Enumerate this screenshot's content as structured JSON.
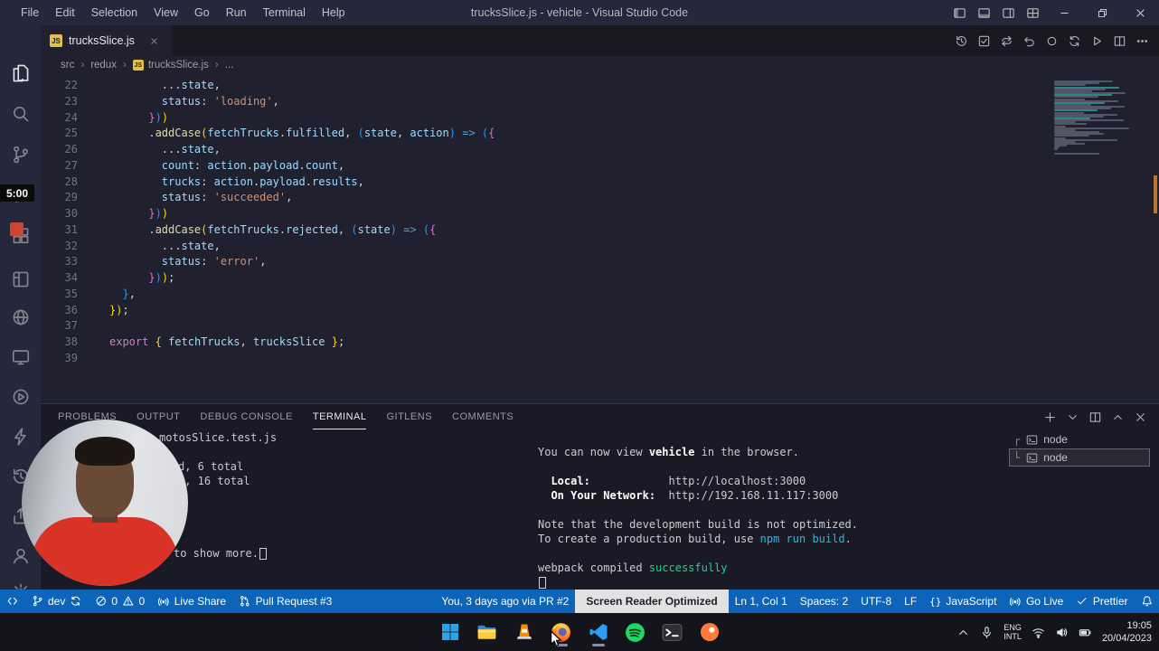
{
  "colors": {
    "statusbar": "#0d64b8",
    "recording_red": "#cf4436",
    "js_yellow": "#e3c04a",
    "cyan": "#29b8db",
    "success_green": "#23d18b"
  },
  "titlebar": {
    "menus": [
      "File",
      "Edit",
      "Selection",
      "View",
      "Go",
      "Run",
      "Terminal",
      "Help"
    ],
    "title": "trucksSlice.js - vehicle - Visual Studio Code"
  },
  "tabbar": {
    "tab_label": "trucksSlice.js",
    "js_badge": "JS",
    "actions": [
      "history",
      "tasks",
      "compare",
      "undo",
      "record",
      "sync",
      "run",
      "split",
      "more"
    ]
  },
  "breadcrumb": [
    "src",
    "redux",
    "trucksSlice.js",
    "..."
  ],
  "activitybar": {
    "recording_timer": "5:00",
    "items": [
      {
        "name": "explorer",
        "icon": "explorer"
      },
      {
        "name": "search",
        "icon": "search"
      },
      {
        "name": "source-control",
        "icon": "scm"
      },
      {
        "name": "run-and-debug",
        "icon": "debug"
      },
      {
        "name": "extensions",
        "icon": "ext"
      },
      {
        "name": "editor-layout",
        "icon": "layout"
      },
      {
        "name": "live-share",
        "icon": "globe"
      },
      {
        "name": "remote-explorer",
        "icon": "monitor"
      },
      {
        "name": "run-app",
        "icon": "playc"
      },
      {
        "name": "thunder-client",
        "icon": "bolt"
      },
      {
        "name": "timeline",
        "icon": "history"
      },
      {
        "name": "share",
        "icon": "share"
      },
      {
        "name": "accounts",
        "icon": "person"
      },
      {
        "name": "manage",
        "icon": "gear"
      }
    ]
  },
  "editor": {
    "lines": [
      {
        "n": 22,
        "s": [
          [
            "d",
            "        ..."
          ],
          [
            "v",
            "state"
          ],
          [
            "d",
            ","
          ]
        ]
      },
      {
        "n": 23,
        "s": [
          [
            "d",
            "        "
          ],
          [
            "v",
            "status"
          ],
          [
            "d",
            ": "
          ],
          [
            "s",
            "'loading'"
          ],
          [
            "d",
            ","
          ]
        ]
      },
      {
        "n": 24,
        "s": [
          [
            "d",
            "      "
          ],
          [
            "p",
            "}"
          ],
          [
            "u",
            ")"
          ],
          [
            "g",
            ")"
          ]
        ]
      },
      {
        "n": 25,
        "s": [
          [
            "d",
            "      ."
          ],
          [
            "f",
            "addCase"
          ],
          [
            "g",
            "("
          ],
          [
            "v",
            "fetchTrucks"
          ],
          [
            "d",
            "."
          ],
          [
            "v",
            "fulfilled"
          ],
          [
            "d",
            ", "
          ],
          [
            "u",
            "("
          ],
          [
            "v",
            "state"
          ],
          [
            "d",
            ", "
          ],
          [
            "v",
            "action"
          ],
          [
            "u",
            ")"
          ],
          [
            "a",
            " => "
          ],
          [
            "u",
            "("
          ],
          [
            "p",
            "{"
          ]
        ]
      },
      {
        "n": 26,
        "s": [
          [
            "d",
            "        ..."
          ],
          [
            "v",
            "state"
          ],
          [
            "d",
            ","
          ]
        ]
      },
      {
        "n": 27,
        "s": [
          [
            "d",
            "        "
          ],
          [
            "v",
            "count"
          ],
          [
            "d",
            ": "
          ],
          [
            "v",
            "action"
          ],
          [
            "d",
            "."
          ],
          [
            "v",
            "payload"
          ],
          [
            "d",
            "."
          ],
          [
            "v",
            "count"
          ],
          [
            "d",
            ","
          ]
        ]
      },
      {
        "n": 28,
        "s": [
          [
            "d",
            "        "
          ],
          [
            "v",
            "trucks"
          ],
          [
            "d",
            ": "
          ],
          [
            "v",
            "action"
          ],
          [
            "d",
            "."
          ],
          [
            "v",
            "payload"
          ],
          [
            "d",
            "."
          ],
          [
            "v",
            "results"
          ],
          [
            "d",
            ","
          ]
        ]
      },
      {
        "n": 29,
        "s": [
          [
            "d",
            "        "
          ],
          [
            "v",
            "status"
          ],
          [
            "d",
            ": "
          ],
          [
            "s",
            "'succeeded'"
          ],
          [
            "d",
            ","
          ]
        ]
      },
      {
        "n": 30,
        "s": [
          [
            "d",
            "      "
          ],
          [
            "p",
            "}"
          ],
          [
            "u",
            ")"
          ],
          [
            "g",
            ")"
          ]
        ]
      },
      {
        "n": 31,
        "s": [
          [
            "d",
            "      ."
          ],
          [
            "f",
            "addCase"
          ],
          [
            "g",
            "("
          ],
          [
            "v",
            "fetchTrucks"
          ],
          [
            "d",
            "."
          ],
          [
            "v",
            "rejected"
          ],
          [
            "d",
            ", "
          ],
          [
            "u",
            "("
          ],
          [
            "v",
            "state"
          ],
          [
            "u",
            ")"
          ],
          [
            "a",
            " => "
          ],
          [
            "u",
            "("
          ],
          [
            "p",
            "{"
          ]
        ]
      },
      {
        "n": 32,
        "s": [
          [
            "d",
            "        ..."
          ],
          [
            "v",
            "state"
          ],
          [
            "d",
            ","
          ]
        ]
      },
      {
        "n": 33,
        "s": [
          [
            "d",
            "        "
          ],
          [
            "v",
            "status"
          ],
          [
            "d",
            ": "
          ],
          [
            "s",
            "'error'"
          ],
          [
            "d",
            ","
          ]
        ]
      },
      {
        "n": 34,
        "s": [
          [
            "d",
            "      "
          ],
          [
            "p",
            "}"
          ],
          [
            "u",
            ")"
          ],
          [
            "g",
            ")"
          ],
          [
            "d",
            ";"
          ]
        ]
      },
      {
        "n": 35,
        "s": [
          [
            "d",
            "  "
          ],
          [
            "u",
            "}"
          ],
          [
            "d",
            ","
          ]
        ]
      },
      {
        "n": 36,
        "s": [
          [
            "g",
            "})"
          ],
          [
            "d",
            ";"
          ]
        ]
      },
      {
        "n": 37,
        "s": []
      },
      {
        "n": 38,
        "s": [
          [
            "k",
            "export"
          ],
          [
            "d",
            " "
          ],
          [
            "g",
            "{"
          ],
          [
            "d",
            " "
          ],
          [
            "v",
            "fetchTrucks"
          ],
          [
            "d",
            ", "
          ],
          [
            "v",
            "trucksSlice"
          ],
          [
            "d",
            " "
          ],
          [
            "g",
            "}"
          ],
          [
            "d",
            ";"
          ]
        ]
      },
      {
        "n": 39,
        "s": []
      }
    ]
  },
  "panel": {
    "tabs": [
      "PROBLEMS",
      "OUTPUT",
      "DEBUG CONSOLE",
      "TERMINAL",
      "GITLENS",
      "COMMENTS"
    ],
    "active_tab": "TERMINAL",
    "actions": [
      "plus",
      "chevdown",
      "split",
      "chevup",
      "close"
    ]
  },
  "terminal": {
    "left_fragments": [
      "motosSlice.test.js",
      "d, 6 total",
      "d, 16 total",
      "to show more."
    ],
    "right_lines": [
      [
        [
          "t",
          "You can now view "
        ],
        [
          "B",
          "vehicle"
        ],
        [
          "t",
          " in the browser."
        ]
      ],
      [],
      [
        [
          "t",
          "  "
        ],
        [
          "B",
          "Local:"
        ],
        [
          "t",
          "            http://localhost:3000"
        ]
      ],
      [
        [
          "t",
          "  "
        ],
        [
          "B",
          "On Your Network:"
        ],
        [
          "t",
          "  http://192.168.11.117:3000"
        ]
      ],
      [],
      [
        [
          "t",
          "Note that the development build is not optimized."
        ]
      ],
      [
        [
          "t",
          "To create a production build, use "
        ],
        [
          "c",
          "npm run build"
        ],
        [
          "t",
          "."
        ]
      ],
      [],
      [
        [
          "t",
          "webpack compiled "
        ],
        [
          "G",
          "successfully"
        ]
      ],
      [
        [
          "cur",
          ""
        ]
      ]
    ],
    "processes": [
      {
        "tree": "┌",
        "label": "node",
        "selected": false
      },
      {
        "tree": "└",
        "label": "node",
        "selected": true
      }
    ]
  },
  "statusbar": {
    "branch": "dev",
    "errors": "0",
    "warnings": "0",
    "live_share": "Live Share",
    "pull_request": "Pull Request #3",
    "blame": "You, 3 days ago via PR #2",
    "screen_reader": "Screen Reader Optimized",
    "cursor": "Ln 1, Col 1",
    "indent": "Spaces: 2",
    "encoding": "UTF-8",
    "eol": "LF",
    "braces": "{}",
    "language": "JavaScript",
    "go_live": "Go Live",
    "formatter": "Prettier"
  },
  "taskbar": {
    "apps": [
      {
        "name": "start",
        "icon": "start",
        "running": false
      },
      {
        "name": "file-explorer",
        "icon": "explorerapp",
        "running": false
      },
      {
        "name": "vlc",
        "icon": "vlc",
        "running": false
      },
      {
        "name": "firefox",
        "icon": "firefox",
        "running": true
      },
      {
        "name": "vscode",
        "icon": "vscodeapp",
        "running": true
      },
      {
        "name": "spotify",
        "icon": "spotify",
        "running": false
      },
      {
        "name": "terminal",
        "icon": "termapp",
        "running": false
      },
      {
        "name": "postman",
        "icon": "orangeapp",
        "running": false
      }
    ],
    "tray": {
      "lang1": "ENG",
      "lang2": "INTL",
      "time": "19:05",
      "date": "20/04/2023"
    }
  }
}
